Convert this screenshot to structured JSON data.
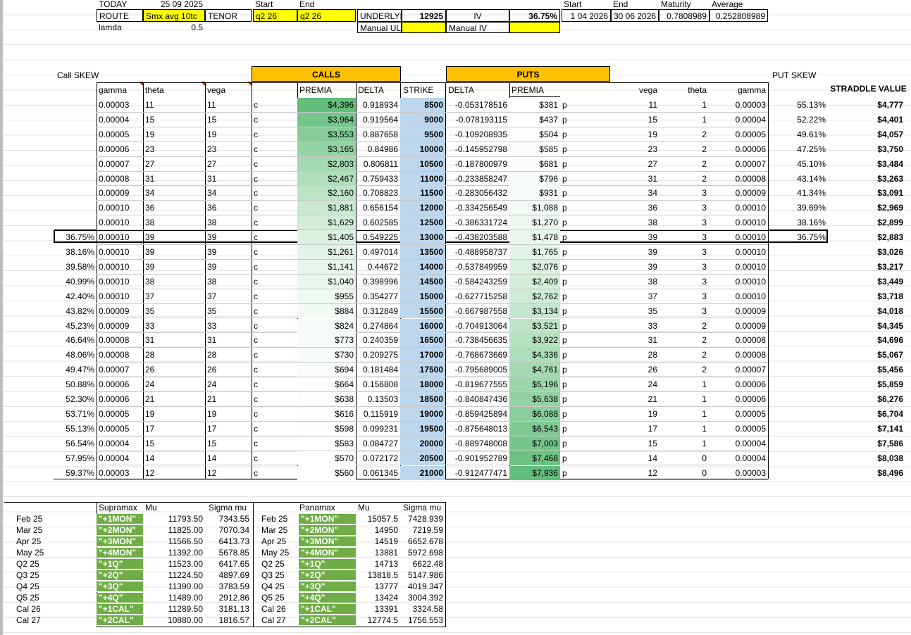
{
  "header": {
    "today_label": "TODAY",
    "today_value": "25 09 2025",
    "start_label": "Start",
    "end_label": "End",
    "route_label": "ROUTE",
    "route_value": "Smx avg 10tc",
    "tenor_label": "TENOR",
    "tenor_start": "q2 26",
    "tenor_end": "q2 26",
    "underlying_label": "UNDERLYI",
    "underlying_value": "12925",
    "iv_label": "IV",
    "iv_value": "36.75%",
    "start2_label": "Start",
    "end2_label": "End",
    "maturity_label": "Maturity",
    "average_label": "Average",
    "start2_value": "1 04 2026",
    "end2_value": "30 06 2026",
    "maturity_value": "0.7808989",
    "average_value": "0.252808989",
    "lamda_label": "lamda",
    "lamda_value": "0.5",
    "manual_ul_label": "Manual UL",
    "manual_iv_label": "Manual IV"
  },
  "sections": {
    "call_skew": "Call SKEW",
    "calls": "CALLS",
    "puts": "PUTS",
    "put_skew": "PUT SKEW",
    "straddle": "STRADDLE VALUE"
  },
  "columns": {
    "gamma": "gamma",
    "theta": "theta",
    "vega": "vega",
    "premia": "PREMIA",
    "delta": "DELTA",
    "strike": "STRIKE",
    "put_delta": "DELTA",
    "put_premia": "PREMIA",
    "put_vega": "vega",
    "put_theta": "theta",
    "put_gamma": "gamma"
  },
  "rows": [
    {
      "cskew": "",
      "gamma": "0.00003",
      "theta": "11",
      "vega": "11",
      "cp": "c",
      "premia": "$4,396",
      "delta": "0.918934",
      "strike": "8500",
      "pdelta": "-0.053178516",
      "ppremia": "$381",
      "pp": "p",
      "pvega": "11",
      "ptheta": "1",
      "pgamma": "0.00003",
      "pskew": "55.13%",
      "straddle": "$4,777"
    },
    {
      "cskew": "",
      "gamma": "0.00004",
      "theta": "15",
      "vega": "15",
      "cp": "c",
      "premia": "$3,964",
      "delta": "0.919564",
      "strike": "9000",
      "pdelta": "-0.078193115",
      "ppremia": "$437",
      "pp": "p",
      "pvega": "15",
      "ptheta": "1",
      "pgamma": "0.00004",
      "pskew": "52.22%",
      "straddle": "$4,401"
    },
    {
      "cskew": "",
      "gamma": "0.00005",
      "theta": "19",
      "vega": "19",
      "cp": "c",
      "premia": "$3,553",
      "delta": "0.887658",
      "strike": "9500",
      "pdelta": "-0.109208935",
      "ppremia": "$504",
      "pp": "p",
      "pvega": "19",
      "ptheta": "2",
      "pgamma": "0.00005",
      "pskew": "49.61%",
      "straddle": "$4,057"
    },
    {
      "cskew": "",
      "gamma": "0.00006",
      "theta": "23",
      "vega": "23",
      "cp": "c",
      "premia": "$3,165",
      "delta": "0.84986",
      "strike": "10000",
      "pdelta": "-0.145952798",
      "ppremia": "$585",
      "pp": "p",
      "pvega": "23",
      "ptheta": "2",
      "pgamma": "0.00006",
      "pskew": "47.25%",
      "straddle": "$3,750"
    },
    {
      "cskew": "",
      "gamma": "0.00007",
      "theta": "27",
      "vega": "27",
      "cp": "c",
      "premia": "$2,803",
      "delta": "0.806811",
      "strike": "10500",
      "pdelta": "-0.187800979",
      "ppremia": "$681",
      "pp": "p",
      "pvega": "27",
      "ptheta": "2",
      "pgamma": "0.00007",
      "pskew": "45.10%",
      "straddle": "$3,484"
    },
    {
      "cskew": "",
      "gamma": "0.00008",
      "theta": "31",
      "vega": "31",
      "cp": "c",
      "premia": "$2,467",
      "delta": "0.759433",
      "strike": "11000",
      "pdelta": "-0.233858247",
      "ppremia": "$796",
      "pp": "p",
      "pvega": "31",
      "ptheta": "2",
      "pgamma": "0.00008",
      "pskew": "43.14%",
      "straddle": "$3,263"
    },
    {
      "cskew": "",
      "gamma": "0.00009",
      "theta": "34",
      "vega": "34",
      "cp": "c",
      "premia": "$2,160",
      "delta": "0.708823",
      "strike": "11500",
      "pdelta": "-0.283056432",
      "ppremia": "$931",
      "pp": "p",
      "pvega": "34",
      "ptheta": "3",
      "pgamma": "0.00009",
      "pskew": "41.34%",
      "straddle": "$3,091"
    },
    {
      "cskew": "",
      "gamma": "0.00010",
      "theta": "36",
      "vega": "36",
      "cp": "c",
      "premia": "$1,881",
      "delta": "0.656154",
      "strike": "12000",
      "pdelta": "-0.334256549",
      "ppremia": "$1,088",
      "pp": "p",
      "pvega": "36",
      "ptheta": "3",
      "pgamma": "0.00010",
      "pskew": "39.69%",
      "straddle": "$2,969"
    },
    {
      "cskew": "",
      "gamma": "0.00010",
      "theta": "38",
      "vega": "38",
      "cp": "c",
      "premia": "$1,629",
      "delta": "0.602585",
      "strike": "12500",
      "pdelta": "-0.386331724",
      "ppremia": "$1,270",
      "pp": "p",
      "pvega": "38",
      "ptheta": "3",
      "pgamma": "0.00010",
      "pskew": "38.16%",
      "straddle": "$2,899"
    },
    {
      "cskew": "36.75%",
      "gamma": "0.00010",
      "theta": "39",
      "vega": "39",
      "cp": "c",
      "premia": "$1,405",
      "delta": "0.549225",
      "strike": "13000",
      "pdelta": "-0.438203588",
      "ppremia": "$1,478",
      "pp": "p",
      "pvega": "39",
      "ptheta": "3",
      "pgamma": "0.00010",
      "pskew": "36.75%",
      "straddle": "$2,883"
    },
    {
      "cskew": "38.16%",
      "gamma": "0.00010",
      "theta": "39",
      "vega": "39",
      "cp": "c",
      "premia": "$1,261",
      "delta": "0.497014",
      "strike": "13500",
      "pdelta": "-0.488958737",
      "ppremia": "$1,765",
      "pp": "p",
      "pvega": "39",
      "ptheta": "3",
      "pgamma": "0.00010",
      "pskew": "",
      "straddle": "$3,026"
    },
    {
      "cskew": "39.58%",
      "gamma": "0.00010",
      "theta": "39",
      "vega": "39",
      "cp": "c",
      "premia": "$1,141",
      "delta": "0.44672",
      "strike": "14000",
      "pdelta": "-0.537849959",
      "ppremia": "$2,076",
      "pp": "p",
      "pvega": "39",
      "ptheta": "3",
      "pgamma": "0.00010",
      "pskew": "",
      "straddle": "$3,217"
    },
    {
      "cskew": "40.99%",
      "gamma": "0.00010",
      "theta": "38",
      "vega": "38",
      "cp": "c",
      "premia": "$1,040",
      "delta": "0.398996",
      "strike": "14500",
      "pdelta": "-0.584243259",
      "ppremia": "$2,409",
      "pp": "p",
      "pvega": "38",
      "ptheta": "3",
      "pgamma": "0.00010",
      "pskew": "",
      "straddle": "$3,449"
    },
    {
      "cskew": "42.40%",
      "gamma": "0.00010",
      "theta": "37",
      "vega": "37",
      "cp": "c",
      "premia": "$955",
      "delta": "0.354277",
      "strike": "15000",
      "pdelta": "-0.627715258",
      "ppremia": "$2,762",
      "pp": "p",
      "pvega": "37",
      "ptheta": "3",
      "pgamma": "0.00010",
      "pskew": "",
      "straddle": "$3,718"
    },
    {
      "cskew": "43.82%",
      "gamma": "0.00009",
      "theta": "35",
      "vega": "35",
      "cp": "c",
      "premia": "$884",
      "delta": "0.312849",
      "strike": "15500",
      "pdelta": "-0.667987558",
      "ppremia": "$3,134",
      "pp": "p",
      "pvega": "35",
      "ptheta": "3",
      "pgamma": "0.00009",
      "pskew": "",
      "straddle": "$4,018"
    },
    {
      "cskew": "45.23%",
      "gamma": "0.00009",
      "theta": "33",
      "vega": "33",
      "cp": "c",
      "premia": "$824",
      "delta": "0.274864",
      "strike": "16000",
      "pdelta": "-0.704913064",
      "ppremia": "$3,521",
      "pp": "p",
      "pvega": "33",
      "ptheta": "2",
      "pgamma": "0.00009",
      "pskew": "",
      "straddle": "$4,345"
    },
    {
      "cskew": "46.64%",
      "gamma": "0.00008",
      "theta": "31",
      "vega": "31",
      "cp": "c",
      "premia": "$773",
      "delta": "0.240359",
      "strike": "16500",
      "pdelta": "-0.738456635",
      "ppremia": "$3,922",
      "pp": "p",
      "pvega": "31",
      "ptheta": "2",
      "pgamma": "0.00008",
      "pskew": "",
      "straddle": "$4,696"
    },
    {
      "cskew": "48.06%",
      "gamma": "0.00008",
      "theta": "28",
      "vega": "28",
      "cp": "c",
      "premia": "$730",
      "delta": "0.209275",
      "strike": "17000",
      "pdelta": "-0.768673669",
      "ppremia": "$4,336",
      "pp": "p",
      "pvega": "28",
      "ptheta": "2",
      "pgamma": "0.00008",
      "pskew": "",
      "straddle": "$5,067"
    },
    {
      "cskew": "49.47%",
      "gamma": "0.00007",
      "theta": "26",
      "vega": "26",
      "cp": "c",
      "premia": "$694",
      "delta": "0.181484",
      "strike": "17500",
      "pdelta": "-0.795689005",
      "ppremia": "$4,761",
      "pp": "p",
      "pvega": "26",
      "ptheta": "2",
      "pgamma": "0.00007",
      "pskew": "",
      "straddle": "$5,456"
    },
    {
      "cskew": "50.88%",
      "gamma": "0.00006",
      "theta": "24",
      "vega": "24",
      "cp": "c",
      "premia": "$664",
      "delta": "0.156808",
      "strike": "18000",
      "pdelta": "-0.819677555",
      "ppremia": "$5,196",
      "pp": "p",
      "pvega": "24",
      "ptheta": "1",
      "pgamma": "0.00006",
      "pskew": "",
      "straddle": "$5,859"
    },
    {
      "cskew": "52.30%",
      "gamma": "0.00006",
      "theta": "21",
      "vega": "21",
      "cp": "c",
      "premia": "$638",
      "delta": "0.13503",
      "strike": "18500",
      "pdelta": "-0.840847436",
      "ppremia": "$5,638",
      "pp": "p",
      "pvega": "21",
      "ptheta": "1",
      "pgamma": "0.00006",
      "pskew": "",
      "straddle": "$6,276"
    },
    {
      "cskew": "53.71%",
      "gamma": "0.00005",
      "theta": "19",
      "vega": "19",
      "cp": "c",
      "premia": "$616",
      "delta": "0.115919",
      "strike": "19000",
      "pdelta": "-0.859425894",
      "ppremia": "$6,088",
      "pp": "p",
      "pvega": "19",
      "ptheta": "1",
      "pgamma": "0.00005",
      "pskew": "",
      "straddle": "$6,704"
    },
    {
      "cskew": "55.13%",
      "gamma": "0.00005",
      "theta": "17",
      "vega": "17",
      "cp": "c",
      "premia": "$598",
      "delta": "0.099231",
      "strike": "19500",
      "pdelta": "-0.875648013",
      "ppremia": "$6,543",
      "pp": "p",
      "pvega": "17",
      "ptheta": "1",
      "pgamma": "0.00005",
      "pskew": "",
      "straddle": "$7,141"
    },
    {
      "cskew": "56.54%",
      "gamma": "0.00004",
      "theta": "15",
      "vega": "15",
      "cp": "c",
      "premia": "$583",
      "delta": "0.084727",
      "strike": "20000",
      "pdelta": "-0.889748008",
      "ppremia": "$7,003",
      "pp": "p",
      "pvega": "15",
      "ptheta": "1",
      "pgamma": "0.00004",
      "pskew": "",
      "straddle": "$7,586"
    },
    {
      "cskew": "57.95%",
      "gamma": "0.00004",
      "theta": "14",
      "vega": "14",
      "cp": "c",
      "premia": "$570",
      "delta": "0.072172",
      "strike": "20500",
      "pdelta": "-0.901952789",
      "ppremia": "$7,468",
      "pp": "p",
      "pvega": "14",
      "ptheta": "0",
      "pgamma": "0.00004",
      "pskew": "",
      "straddle": "$8,038"
    },
    {
      "cskew": "59.37%",
      "gamma": "0.00003",
      "theta": "12",
      "vega": "12",
      "cp": "c",
      "premia": "$560",
      "delta": "0.061345",
      "strike": "21000",
      "pdelta": "-0.912477471",
      "ppremia": "$7,936",
      "pp": "p",
      "pvega": "12",
      "ptheta": "0",
      "pgamma": "0.00003",
      "pskew": "",
      "straddle": "$8,496"
    }
  ],
  "supramax": {
    "title": "Supramax",
    "mu_label": "Mu",
    "sigma_label": "Sigma mu",
    "rows": [
      {
        "period": "Feb 25",
        "code": "\"+1MON\"",
        "mu": "11793.50",
        "sigma": "7343.55"
      },
      {
        "period": "Mar 25",
        "code": "\"+2MON\"",
        "mu": "11825.00",
        "sigma": "7070.34"
      },
      {
        "period": "Apr 25",
        "code": "\"+3MON\"",
        "mu": "11566.50",
        "sigma": "6413.73"
      },
      {
        "period": "May 25",
        "code": "\"+4MON\"",
        "mu": "11392.00",
        "sigma": "5678.85"
      },
      {
        "period": "Q2 25",
        "code": "\"+1Q\"",
        "mu": "11523.00",
        "sigma": "6417.65"
      },
      {
        "period": "Q3 25",
        "code": "\"+2Q\"",
        "mu": "11224.50",
        "sigma": "4897.69"
      },
      {
        "period": "Q4 25",
        "code": "\"+3Q\"",
        "mu": "11390.00",
        "sigma": "3783.59"
      },
      {
        "period": "Q5 25",
        "code": "\"+4Q\"",
        "mu": "11489.00",
        "sigma": "2912.86"
      },
      {
        "period": "Cal 26",
        "code": "\"+1CAL\"",
        "mu": "11289.50",
        "sigma": "3181.13"
      },
      {
        "period": "Cal 27",
        "code": "\"+2CAL\"",
        "mu": "10880.00",
        "sigma": "1816.57"
      }
    ]
  },
  "panamax": {
    "title": "Panamax",
    "mu_label": "Mu",
    "sigma_label": "Sigma mu",
    "rows": [
      {
        "period": "Feb 25",
        "code": "\"+1MON\"",
        "mu": "15057.5",
        "sigma": "7428.939"
      },
      {
        "period": "Mar 25",
        "code": "\"+2MON\"",
        "mu": "14950",
        "sigma": "7219.59"
      },
      {
        "period": "Apr 25",
        "code": "\"+3MON\"",
        "mu": "14519",
        "sigma": "6652.678"
      },
      {
        "period": "May 25",
        "code": "\"+4MON\"",
        "mu": "13881",
        "sigma": "5972.698"
      },
      {
        "period": "Q2 25",
        "code": "\"+1Q\"",
        "mu": "14713",
        "sigma": "6622.48"
      },
      {
        "period": "Q3 25",
        "code": "\"+2Q\"",
        "mu": "13818.5",
        "sigma": "5147.986"
      },
      {
        "period": "Q4 25",
        "code": "\"+3Q\"",
        "mu": "13777",
        "sigma": "4019.347"
      },
      {
        "period": "Q5 25",
        "code": "\"+4Q\"",
        "mu": "13424",
        "sigma": "3004.392"
      },
      {
        "period": "Cal 26",
        "code": "\"+1CAL\"",
        "mu": "13391",
        "sigma": "3324.58"
      },
      {
        "period": "Cal 27",
        "code": "\"+2CAL\"",
        "mu": "12774.5",
        "sigma": "1756.553"
      }
    ]
  },
  "colors": {
    "yellow": "#ffff00",
    "orange": "#ffc000",
    "green": "#70ad47",
    "call_scale_high": "#63be7b",
    "put_scale_high": "#63be7b",
    "strike_blue": "#bdd7ee"
  }
}
